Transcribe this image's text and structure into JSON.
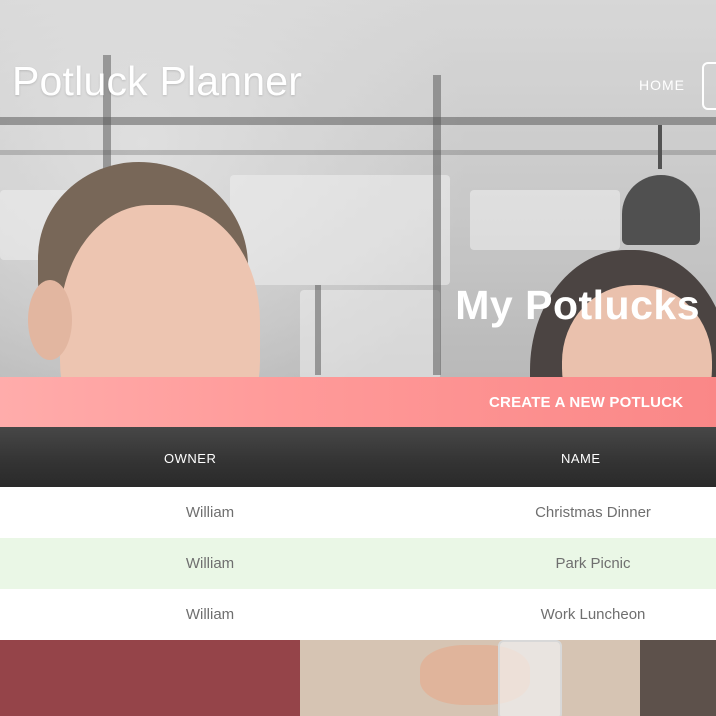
{
  "header": {
    "brand": "Potluck Planner",
    "nav": {
      "home_label": "HOME"
    }
  },
  "hero": {
    "title": "My Potlucks"
  },
  "actions": {
    "create_label": "CREATE A NEW POTLUCK"
  },
  "table": {
    "columns": [
      "OWNER",
      "NAME"
    ],
    "rows": [
      {
        "owner": "William",
        "name": "Christmas Dinner"
      },
      {
        "owner": "William",
        "name": "Park Picnic"
      },
      {
        "owner": "William",
        "name": "Work Luncheon"
      }
    ]
  },
  "colors": {
    "create_bar": "#ff9a99",
    "table_header": "#333333",
    "row_alt": "#eaf7e6"
  }
}
